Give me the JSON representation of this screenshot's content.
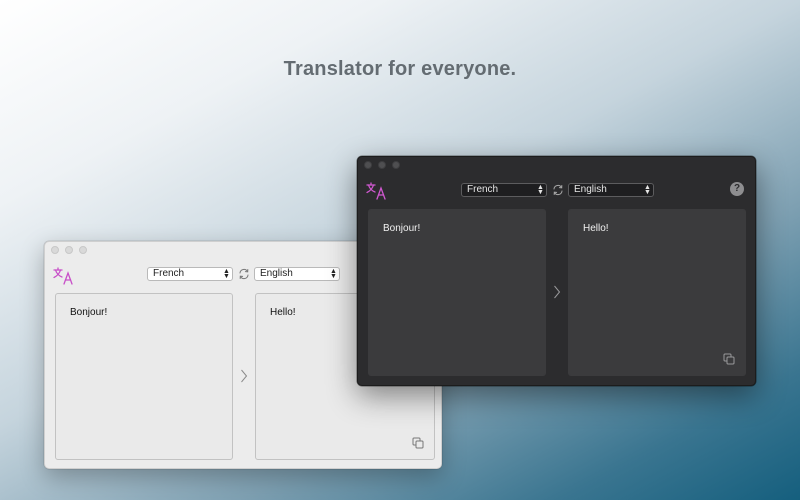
{
  "headline": "Translator for everyone.",
  "light_window": {
    "source_language": "French",
    "target_language": "English",
    "source_text": "Bonjour!",
    "translated_text": "Hello!"
  },
  "dark_window": {
    "source_language": "French",
    "target_language": "English",
    "source_text": "Bonjour!",
    "translated_text": "Hello!",
    "help_label": "?"
  },
  "icons": {
    "logo": "translate-icon",
    "swap": "swap-icon",
    "arrow": "chevron-right-icon",
    "copy": "copy-icon",
    "caret": "up-down-caret-icon"
  },
  "colors": {
    "accent_logo": "#c84fc8",
    "light_background": "#ececec",
    "dark_background": "#2c2c2e"
  }
}
